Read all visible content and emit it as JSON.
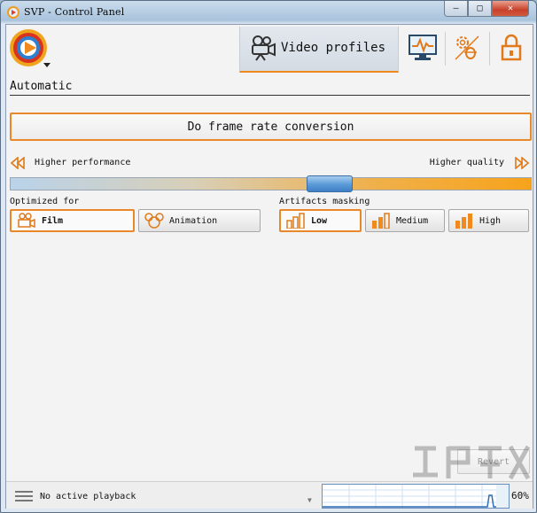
{
  "window": {
    "title": "SVP - Control Panel",
    "controls": {
      "minimize": "–",
      "maximize": "□",
      "close": "✕"
    }
  },
  "header": {
    "logo": "svp-logo-icon",
    "tabs": [
      {
        "label": "Video profiles",
        "icon": "video-camera-icon",
        "active": true
      },
      {
        "label": "",
        "icon": "monitor-icon",
        "active": false
      },
      {
        "label": "",
        "icon": "settings-bug-icon",
        "active": false
      },
      {
        "label": "",
        "icon": "lock-icon",
        "active": false
      }
    ]
  },
  "profile": {
    "section_title": "Automatic",
    "frame_rate_button": "Do frame rate conversion",
    "performance_label": "Higher performance",
    "quality_label": "Higher quality",
    "slider_value": 0.6
  },
  "optimized_for": {
    "label": "Optimized for",
    "options": [
      {
        "label": "Film",
        "icon": "film-camera-icon",
        "selected": true
      },
      {
        "label": "Animation",
        "icon": "mouse-head-icon",
        "selected": false
      }
    ]
  },
  "artifacts_masking": {
    "label": "Artifacts masking",
    "options": [
      {
        "label": "Low",
        "icon": "bars-icon",
        "selected": true
      },
      {
        "label": "Medium",
        "icon": "bars-icon",
        "selected": false
      },
      {
        "label": "High",
        "icon": "bars-icon",
        "selected": false
      }
    ]
  },
  "revert_label": "Revert",
  "status": {
    "text": "No active playback",
    "percent": "60%"
  },
  "colors": {
    "accent": "#e9882a",
    "slider_thumb": "#5a9ad8",
    "graph_line": "#2f6db8"
  }
}
